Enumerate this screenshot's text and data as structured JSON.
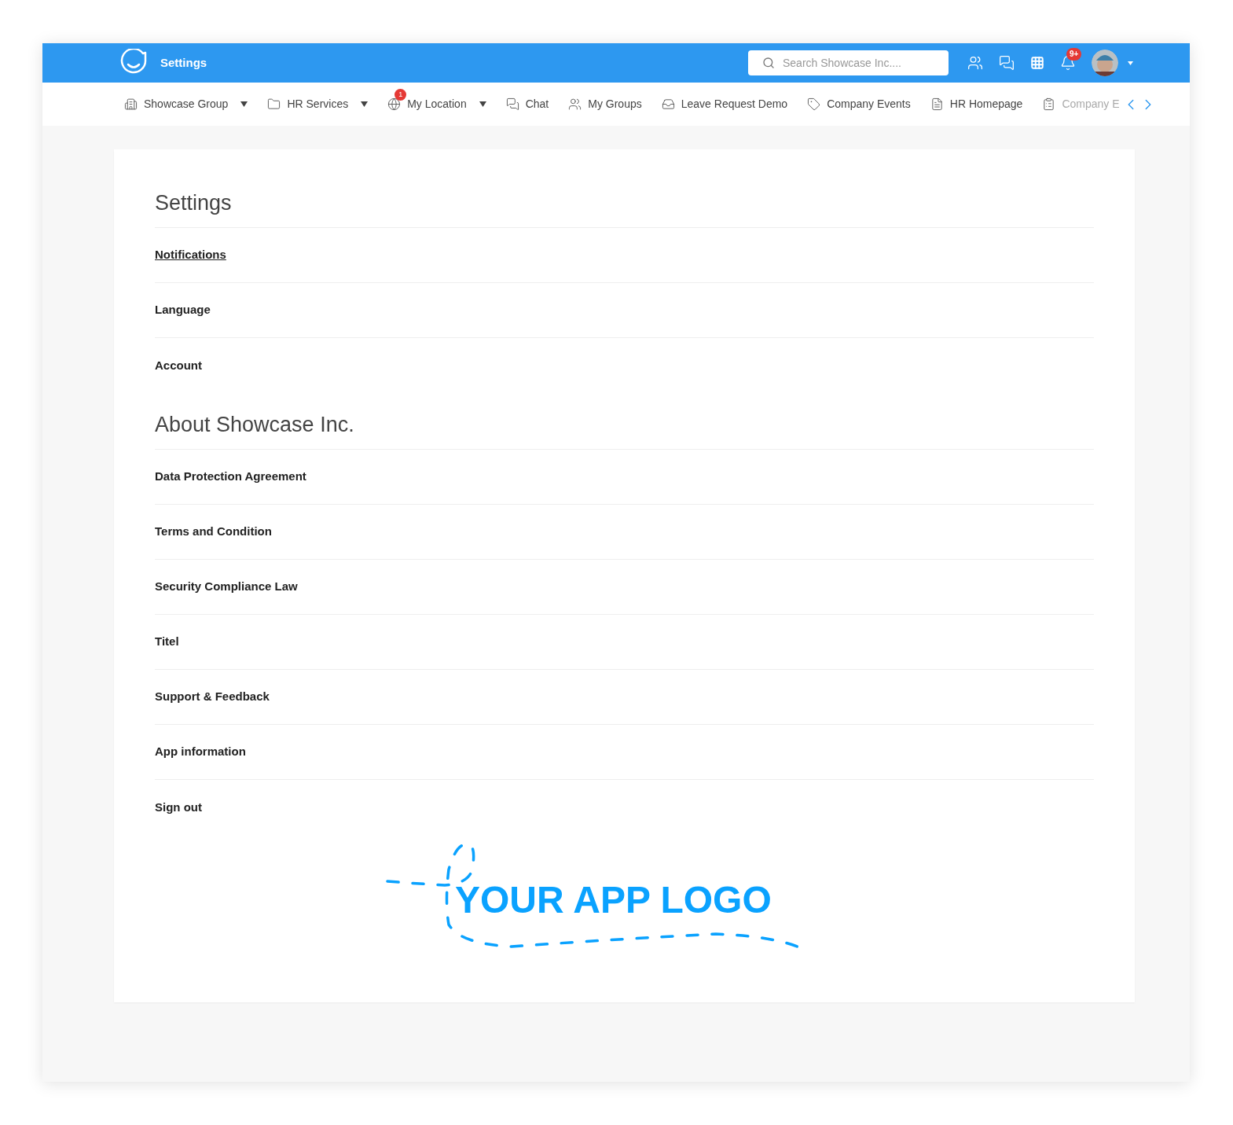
{
  "header": {
    "title": "Settings",
    "search": {
      "placeholder": "Search Showcase Inc...."
    },
    "notification_badge": "9+"
  },
  "nav": {
    "items": [
      {
        "kind": "building",
        "label": "Showcase Group",
        "dropdown": true
      },
      {
        "kind": "folder",
        "label": "HR Services",
        "dropdown": true
      },
      {
        "kind": "globe",
        "label": "My Location",
        "dropdown": true,
        "badge": "1"
      },
      {
        "kind": "chat",
        "label": "Chat",
        "dropdown": false
      },
      {
        "kind": "people",
        "label": "My Groups",
        "dropdown": false
      },
      {
        "kind": "tray",
        "label": "Leave Request Demo",
        "dropdown": false
      },
      {
        "kind": "tag",
        "label": "Company Events",
        "dropdown": false
      },
      {
        "kind": "document",
        "label": "HR Homepage",
        "dropdown": false
      },
      {
        "kind": "clipboard",
        "label": "Company E",
        "dropdown": false,
        "faded": true
      }
    ]
  },
  "sections": [
    {
      "title": "Settings",
      "items": [
        {
          "label": "Notifications",
          "selected": true
        },
        {
          "label": "Language",
          "selected": false
        },
        {
          "label": "Account",
          "selected": false
        }
      ]
    },
    {
      "title": "About Showcase Inc.",
      "items": [
        {
          "label": "Data Protection Agreement",
          "selected": false
        },
        {
          "label": "Terms and Condition",
          "selected": false
        },
        {
          "label": "Security Compliance Law",
          "selected": false
        },
        {
          "label": "Titel",
          "selected": false
        },
        {
          "label": "Support & Feedback",
          "selected": false
        },
        {
          "label": "App information",
          "selected": false
        },
        {
          "label": "Sign out",
          "selected": false
        }
      ]
    }
  ],
  "logo": {
    "text": "YOUR APP LOGO"
  }
}
